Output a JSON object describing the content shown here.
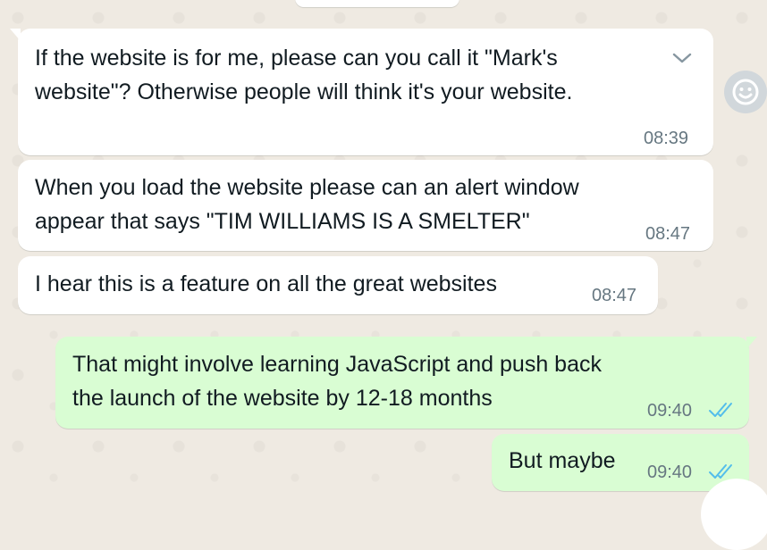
{
  "colors": {
    "incoming_bubble": "#ffffff",
    "outgoing_bubble": "#d9fdd3",
    "read_ticks": "#53bdeb",
    "chat_background": "#efeae2"
  },
  "messages": [
    {
      "direction": "incoming",
      "lines": [
        "If the website is for me, please can you call it \"Mark's",
        "website\"? Otherwise people will think it's your website."
      ],
      "time": "08:39"
    },
    {
      "direction": "incoming",
      "lines": [
        "When you load the website please can an alert window",
        "appear that says \"TIM WILLIAMS IS A SMELTER\""
      ],
      "time": "08:47"
    },
    {
      "direction": "incoming",
      "lines": [
        "I hear this is a feature on all the great websites"
      ],
      "time": "08:47"
    },
    {
      "direction": "outgoing",
      "lines": [
        "That might involve learning JavaScript and push back",
        "the launch of the website by 12-18 months"
      ],
      "time": "09:40",
      "status": "read"
    },
    {
      "direction": "outgoing",
      "lines": [
        "But maybe"
      ],
      "time": "09:40",
      "status": "read"
    }
  ],
  "icons": {
    "message_menu": "chevron-down-icon",
    "reaction": "emoji-smile-icon",
    "read_receipt": "double-check-icon"
  }
}
